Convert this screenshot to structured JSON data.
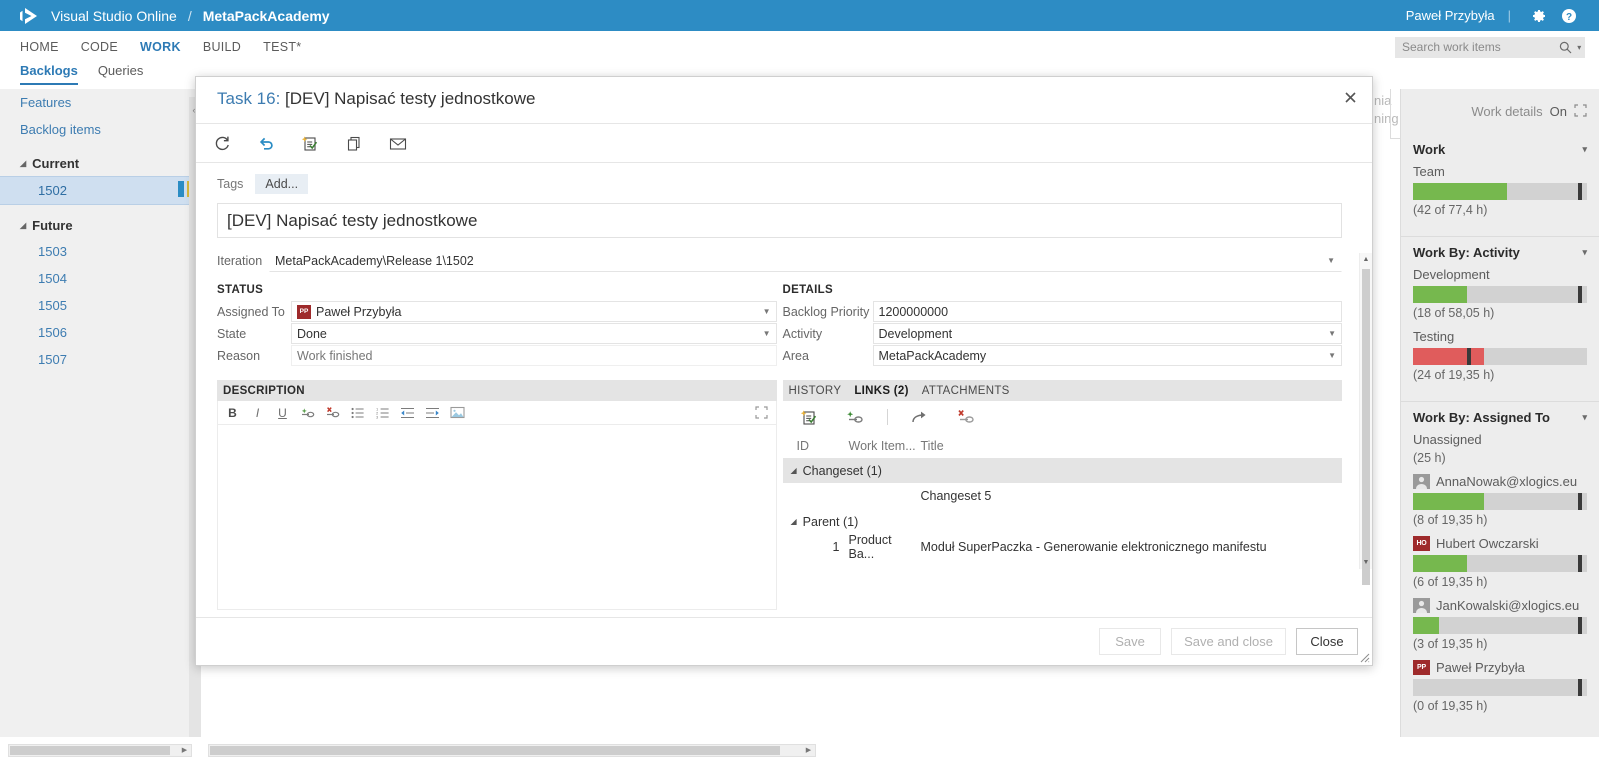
{
  "topbar": {
    "logo_icon": "visual-studio-logo",
    "brand": "Visual Studio Online",
    "separator": "/",
    "project": "MetaPackAcademy",
    "user": "Paweł Przybyła",
    "divider": "|",
    "settings_icon": "gear-icon",
    "help_icon": "help-icon"
  },
  "nav": {
    "items": [
      {
        "label": "HOME",
        "active": false
      },
      {
        "label": "CODE",
        "active": false
      },
      {
        "label": "WORK",
        "active": true
      },
      {
        "label": "BUILD",
        "active": false
      },
      {
        "label": "TEST*",
        "active": false
      }
    ],
    "search": {
      "placeholder": "Search work items",
      "value": "",
      "icon": "search-icon",
      "caret": "▾"
    }
  },
  "subtabs": [
    {
      "label": "Backlogs",
      "active": true
    },
    {
      "label": "Queries",
      "active": false
    }
  ],
  "sidebar": {
    "collapse_icon": "chevron-left-icon",
    "links": [
      "Features",
      "Backlog items"
    ],
    "groups": [
      {
        "name": "Current",
        "tri": "◢",
        "items": [
          {
            "id": "1502",
            "selected": true,
            "bars": [
              "#2a8cc4",
              "#d6b83c"
            ]
          }
        ]
      },
      {
        "name": "Future",
        "tri": "◢",
        "items": [
          {
            "id": "1503",
            "selected": false,
            "bars": []
          },
          {
            "id": "1504",
            "selected": false,
            "bars": []
          },
          {
            "id": "1505",
            "selected": false,
            "bars": []
          },
          {
            "id": "1506",
            "selected": false,
            "bars": []
          },
          {
            "id": "1507",
            "selected": false,
            "bars": []
          }
        ]
      }
    ]
  },
  "background": {
    "fragment_line1": "nia",
    "fragment_line2": "ning"
  },
  "work_details": {
    "header_label": "Work details",
    "header_state": "On",
    "expand_icon": "expand-icon",
    "sections": [
      {
        "title": "Work",
        "chevron": "▾",
        "items": [
          {
            "label": "Team",
            "avatar": null,
            "fill_pct": 54,
            "fill_color": "#76b84e",
            "marker_pct": 95,
            "caption": "(42 of 77,4 h)"
          }
        ]
      },
      {
        "title": "Work By: Activity",
        "chevron": "▾",
        "items": [
          {
            "label": "Development",
            "avatar": null,
            "fill_pct": 31,
            "fill_color": "#76b84e",
            "marker_pct": 95,
            "caption": "(18 of 58,05 h)"
          },
          {
            "label": "Testing",
            "avatar": null,
            "fill_pct": 41,
            "fill_color": "#e05c5c",
            "marker_pct": 31,
            "caption": "(24 of 19,35 h)"
          }
        ]
      },
      {
        "title": "Work By: Assigned To",
        "chevron": "▾",
        "items": [
          {
            "label": "Unassigned",
            "avatar": null,
            "fill_pct": null,
            "fill_color": null,
            "marker_pct": null,
            "caption": "(25 h)"
          },
          {
            "label": "AnnaNowak@xlogics.eu",
            "avatar": {
              "type": "photo",
              "initials": "",
              "color": "#9a9a9a"
            },
            "fill_pct": 41,
            "fill_color": "#76b84e",
            "marker_pct": 95,
            "caption": "(8 of 19,35 h)"
          },
          {
            "label": "Hubert Owczarski",
            "avatar": {
              "type": "initials",
              "initials": "HO",
              "color": "#9e2a2b"
            },
            "fill_pct": 31,
            "fill_color": "#76b84e",
            "marker_pct": 95,
            "caption": "(6 of 19,35 h)"
          },
          {
            "label": "JanKowalski@xlogics.eu",
            "avatar": {
              "type": "photo",
              "initials": "",
              "color": "#9a9a9a"
            },
            "fill_pct": 15,
            "fill_color": "#76b84e",
            "marker_pct": 95,
            "caption": "(3 of 19,35 h)"
          },
          {
            "label": "Paweł Przybyła",
            "avatar": {
              "type": "initials",
              "initials": "PP",
              "color": "#9e2a2b"
            },
            "fill_pct": 0,
            "fill_color": "#76b84e",
            "marker_pct": 95,
            "caption": "(0 of 19,35 h)"
          }
        ]
      }
    ]
  },
  "dialog": {
    "title_id": "Task 16:",
    "title_text": " [DEV] Napisać testy jednostkowe",
    "close_icon": "close-icon",
    "toolbar": [
      {
        "name": "refresh-icon",
        "glyph": "⟳"
      },
      {
        "name": "undo-icon",
        "glyph": "↺"
      },
      {
        "name": "new-linked-work-item-icon",
        "glyph": "✎"
      },
      {
        "name": "copy-icon",
        "glyph": "❐"
      },
      {
        "name": "email-icon",
        "glyph": "✉"
      }
    ],
    "tags": {
      "label": "Tags",
      "add_label": "Add..."
    },
    "work_item_title": "[DEV] Napisać testy jednostkowe",
    "iteration": {
      "label": "Iteration",
      "value": "MetaPackAcademy\\Release 1\\1502"
    },
    "status": {
      "heading": "STATUS",
      "fields": [
        {
          "label": "Assigned To",
          "value": "Paweł Przybyła",
          "avatar": "PP",
          "avatar_color": "#9e2a2b",
          "dropdown": true,
          "readonly": false
        },
        {
          "label": "State",
          "value": "Done",
          "dropdown": true,
          "readonly": false
        },
        {
          "label": "Reason",
          "value": "Work finished",
          "dropdown": false,
          "readonly": true
        }
      ]
    },
    "details": {
      "heading": "DETAILS",
      "fields": [
        {
          "label": "Backlog Priority",
          "value": "1200000000",
          "dropdown": false,
          "readonly": false
        },
        {
          "label": "Activity",
          "value": "Development",
          "dropdown": true,
          "readonly": false
        },
        {
          "label": "Area",
          "value": "MetaPackAcademy",
          "dropdown": true,
          "readonly": false
        }
      ]
    },
    "description": {
      "heading": "DESCRIPTION",
      "toolbar": [
        {
          "name": "bold-icon",
          "glyph": "B"
        },
        {
          "name": "italic-icon",
          "glyph": "I"
        },
        {
          "name": "underline-icon",
          "glyph": "U"
        },
        {
          "name": "link-icon",
          "glyph": "🔗"
        },
        {
          "name": "unlink-icon",
          "glyph": "⛓"
        },
        {
          "name": "bullet-list-icon",
          "glyph": "☰"
        },
        {
          "name": "numbered-list-icon",
          "glyph": "≣"
        },
        {
          "name": "outdent-icon",
          "glyph": "⇤"
        },
        {
          "name": "indent-icon",
          "glyph": "⇥"
        },
        {
          "name": "image-icon",
          "glyph": "🖼"
        }
      ],
      "expand_icon": "expand-icon",
      "body": ""
    },
    "links_panel": {
      "tabs": [
        {
          "label": "HISTORY",
          "active": false
        },
        {
          "label": "LINKS (2)",
          "active": true
        },
        {
          "label": "ATTACHMENTS",
          "active": false
        }
      ],
      "toolbar": [
        {
          "name": "new-linked-work-item-icon",
          "glyph": "✎"
        },
        {
          "name": "add-link-icon",
          "glyph": "🔗"
        },
        {
          "name": "open-link-icon",
          "glyph": "↷"
        },
        {
          "name": "delete-link-icon",
          "glyph": "⛓"
        }
      ],
      "columns": [
        "ID",
        "Work Item...",
        "Title"
      ],
      "groups": [
        {
          "name": "Changeset (1)",
          "tri": "◢",
          "rows": [
            {
              "id": "",
              "work_item_type": "",
              "title": "Changeset 5"
            }
          ]
        },
        {
          "name": "Parent (1)",
          "tri": "◢",
          "rows": [
            {
              "id": "1",
              "work_item_type": "Product Ba...",
              "title": "Moduł SuperPaczka - Generowanie elektronicznego manifestu"
            }
          ]
        }
      ]
    },
    "footer": {
      "save": {
        "label": "Save",
        "enabled": false
      },
      "save_and_close": {
        "label": "Save and close",
        "enabled": false
      },
      "close": {
        "label": "Close",
        "enabled": true
      }
    },
    "resize_grip_icon": "resize-grip-icon"
  }
}
